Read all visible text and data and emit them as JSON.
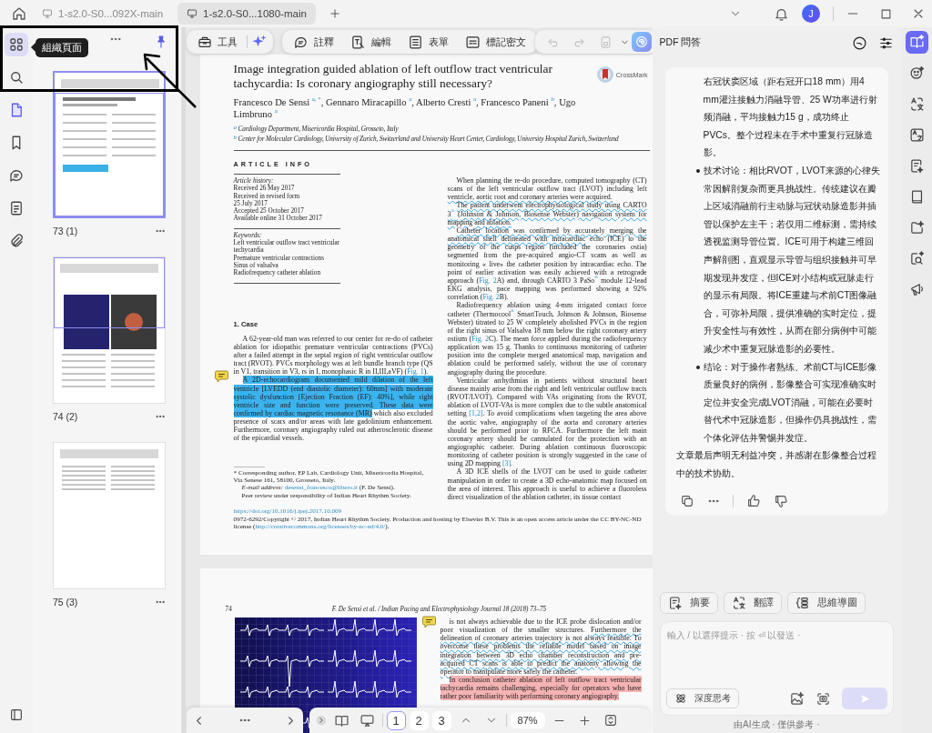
{
  "tabs": [
    {
      "title": "1-s2.0-S0...092X-main",
      "selected": false
    },
    {
      "title": "1-s2.0-S0...1080-main",
      "selected": true
    }
  ],
  "account": {
    "initial": "J"
  },
  "left_rail": [
    {
      "hovered": true,
      "selected": false
    },
    {
      "hovered": false,
      "selected": false
    },
    {
      "hovered": false,
      "selected": true
    },
    {
      "hovered": false,
      "selected": false
    },
    {
      "hovered": false,
      "selected": false
    },
    {
      "hovered": false,
      "selected": false
    },
    {
      "hovered": false,
      "selected": false
    }
  ],
  "tooltip": "組織頁面",
  "thumbnails": [
    {
      "label": "73 (1)",
      "selected": true,
      "in_view": true
    },
    {
      "label": "74 (2)",
      "selected": false,
      "in_view": true
    },
    {
      "label": "75 (3)",
      "selected": false,
      "in_view": false
    }
  ],
  "toolbar": {
    "tools_label": "工具",
    "items": [
      {
        "label": "註釋"
      },
      {
        "label": "編輯"
      },
      {
        "label": "表單"
      },
      {
        "label": "標記密文"
      }
    ],
    "history_buttons": [
      {
        "disabled": true
      },
      {
        "disabled": true
      },
      {
        "disabled": true
      }
    ],
    "ai_assistant": {
      "selected": true
    }
  },
  "document": {
    "page_1": {
      "title": "Image integration guided ablation of left outflow tract ventricular tachycardia: Is coronary angiography still necessary?",
      "crossmark": "CrossMark",
      "authors": "Francesco De Sensi $^{a, *}$, Gennaro Miracapillo $^{a}$, Alberto Cresti $^{a}$, Francesco Paneni $^{b}$, Ugo Limbruno $^{a}$",
      "affiliations": [
        "$^{a}$ Cardiology Department, Misericordia Hospital, Grosseto, Italy",
        "$^{b}$ Center for Molecular Cardiology, University of Zurich, Switzerland and University Heart Center, Cardiology, University Hospital Zurich, Switzerland"
      ],
      "article_info_heading": "ARTICLE INFO",
      "history": [
        "Article history:",
        "Received 26 May 2017",
        "Received in revised form",
        "25 July 2017",
        "Accepted 25 October 2017",
        "Available online 31 October 2017"
      ],
      "keywords": [
        "Keywords:",
        "Left ventricular outflow tract ventricular tachycardia",
        "Premature ventricular contractions",
        "Sinus of valsalva",
        "Radiofrequency catheter ablation"
      ],
      "section_heading": "1. Case",
      "left_paragraphs": [
        [
          {
            "kind": "plain",
            "text": "A 62-year-old man was referred to our center for re-do of catheter ablation for idiopathic premature ventricular contractions (PVCs) after a failed attempt in the septal region of right ventricular outflow tract (RVOT). PVCs morphology was at left bundle branch type (QS in V1, transition in V3, rs in I, monophasic R in II,III,aVF) ("
          },
          {
            "kind": "link",
            "text": "Fig. 1"
          },
          {
            "kind": "plain",
            "text": ")."
          }
        ],
        [
          {
            "kind": "highlight",
            "text": "A 2D-echocardiogram documented mild dilation of the left ventricle [LVEDD (end diastolic diameter): 60mm] with moderate systolic dysfunction [Ejection Fraction (EF): 40%], while right ventricle size and function were preserved. These data were confirmed by cardiac magnetic resonance (MR)"
          },
          {
            "kind": "plain",
            "text": " which also excluded presence of scars and/or areas with late gadolinium enhancement. Furthermore, coronary angiography ruled out atherosclerotic disease of the epicardial vessels."
          }
        ]
      ],
      "footnotes": [
        [
          {
            "kind": "plain",
            "text": "* Corresponding author. EP Lab, Cardiology Unit, Misericordia Hospital, Via Senese 161, 58100, Grosseto, Italy."
          }
        ],
        [
          {
            "kind": "plain",
            "text": "*E-mail address:* "
          },
          {
            "kind": "link",
            "text": "desensi_francesco@libero.it"
          },
          {
            "kind": "plain",
            "text": " (F. De Sensi)."
          }
        ],
        [
          {
            "kind": "plain",
            "text": "Peer review under responsibility of Indian Heart Rhythm Society."
          }
        ]
      ],
      "doi": "https://doi.org/10.1016/j.ipej.2017.10.009",
      "copyright": [
        {
          "kind": "plain",
          "text": "0972-6292/Copyright © 2017, Indian Heart Rhythm Society. Production and hosting by Elsevier B.V. This is an open access article under the CC BY-NC-ND license ("
        },
        {
          "kind": "link",
          "text": "http://creativecommons.org/licenses/by-nc-nd/4.0/"
        },
        {
          "kind": "plain",
          "text": ")."
        }
      ],
      "right_paragraphs": [
        [
          {
            "kind": "plain",
            "text": "When planning the re-do procedure, computed tomography (CT) scans of the left ventricular outflow tract (LVOT) including left "
          },
          {
            "kind": "underline",
            "text": "ventricle, aortic root and coronary arteries were acquired."
          }
        ],
        [
          {
            "kind": "underline",
            "text": "The patient underwent electrophysiological study using CARTO 3$^{®}$ (Johnson & Johnson, Biosense Webster) navigation system for mapping and ablation."
          }
        ],
        [
          {
            "kind": "underline",
            "text": "Catheter location was confirmed by accurately merging the anatomical shell delineated with intracardiac"
          },
          {
            "kind": "plain",
            "text": " echo (ICE) to the geometry of the cusps region (included the coronaries ostia) segmented from the pre-acquired angio-CT scans as well as monitoring « live» the catheter position by intracardiac echo. The point of earlier activation was easily achieved with a retrograde approach ("
          },
          {
            "kind": "link",
            "text": "Fig. 2"
          },
          {
            "kind": "plain",
            "text": "A) and, through CARTO 3 PaSo$^{®}$ module 12-lead EKG analysis, pace mapping was performed showing a 92% correlation ("
          },
          {
            "kind": "link",
            "text": "Fig. 2"
          },
          {
            "kind": "plain",
            "text": "B)."
          }
        ],
        [
          {
            "kind": "plain",
            "text": "Radiofrequency ablation using 4-mm irrigated contact force catheter (Thermocool$^{®}$ SmartTouch, Johnson & Johnson, Biosense Webster) titrated to 25 W completely abolished PVCs in the region of the right sinus of Valsalva 18 mm below the right coronary artery ostium ("
          },
          {
            "kind": "link",
            "text": "Fig. 2"
          },
          {
            "kind": "plain",
            "text": "C). The mean force applied during the radiofrequency application was 15 g. Thanks to continuous monitoring of catheter position into the complete merged anatomical map, navigation and ablation could be performed safely, without the use of coronary angiography during the procedure."
          }
        ],
        [
          {
            "kind": "plain",
            "text": "Ventricular arrhythmias in patients without structural heart disease mainly arise from the right and left ventricular outflow tracts (RVOT/LVOT). Compared with VAs originating from the RVOT, ablation of LVOT-VAs is more complex due to the subtle anatomical setting "
          },
          {
            "kind": "link",
            "text": "[1,2]"
          },
          {
            "kind": "plain",
            "text": ". To avoid complications when targeting the area above the aortic valve, angiography of the aorta and coronary arteries should be performed prior to RFCA. Furthermore the left main coronary artery should be cannulated for the protection with an angiographic catheter. During ablation continuous fluoroscopic monitoring of catheter position is strongly suggested in the case of using 2D mapping "
          },
          {
            "kind": "link",
            "text": "[3]"
          },
          {
            "kind": "plain",
            "text": "."
          }
        ],
        [
          {
            "kind": "plain",
            "text": "A 3D ICE shells of the LVOT can be used to guide catheter manipulation in order to create a 3D echo-anatomic map focused on the area of interest. This approach is useful to achieve a fluoroless direct visualization of the ablation catheter, its tissue contact"
          }
        ]
      ]
    },
    "page_2": {
      "page_number": "74",
      "running_head": "*F. De Sensi et al. / Indian Pacing and Electrophysiology Journal 18 (2018) 73–75*",
      "right_paragraphs": [
        [
          {
            "kind": "plain",
            "text": "is not always achievable due to the ICE probe dislocation and/or poor visualization of the smaller structures. "
          },
          {
            "kind": "underline",
            "text": "Furthermore the delineation of coronary arteries trajectory is not always feasible. To overcome these problems the reliable model based on image integration between 3D echo chamber reconstruction and pre-acquired CT scans is able to predict the anatomy allowing the operator to manipulate more safely the catheter."
          }
        ],
        [
          {
            "kind": "red",
            "text": "In conclusion catheter ablation of left outflow tract ventricular tachycardia remains challenging, especially for operators who have rather poor familiarity with performing coronary angiography."
          }
        ]
      ]
    }
  },
  "page_nav": {
    "pages": [
      {
        "label": "1",
        "selected": true
      },
      {
        "label": "2",
        "selected": false
      },
      {
        "label": "3",
        "selected": false
      }
    ],
    "zoom": "87%"
  },
  "ai_panel": {
    "title": "PDF 問答",
    "answer": [
      {
        "kind": "continuation",
        "text": "右冠状窦区域（距右冠开口18 mm）用4 mm灌注接触力消融导管、25 W功率进行射频消融，平均接触力15 g，成功终止PVCs。整个过程未在手术中重复行冠脉造影。"
      },
      {
        "kind": "bullet",
        "text": "技术讨论：相比RVOT，LVOT来源的心律失常因解剖复杂而更具挑战性。传统建议在瓣上区域消融前行主动脉与冠状动脉造影并插管以保护左主干；若仅用二维标测，需持续透视监测导管位置。ICE可用于构建三维回声解剖图，直观显示导管与组织接触并可早期发现并发症，但ICE对小结构或冠脉走行的显示有局限。将ICE重建与术前CT图像融合，可弥补局限，提供准确的实时定位，提升安全性与有效性，从而在部分病例中可能减少术中重复冠脉造影的必要性。"
      },
      {
        "kind": "bullet",
        "text": "结论：对于操作者熟练、术前CT与ICE影像质量良好的病例，影像整合可实现准确实时定位并安全完成LVOT消融，可能在必要时替代术中冠脉造影，但操作仍具挑战性，需个体化评估并警惕并发症。"
      },
      {
        "kind": "paragraph",
        "text": "文章最后声明无利益冲突，并感谢在影像整合过程中的技术协助。"
      }
    ],
    "chips": [
      {
        "label": "摘要"
      },
      {
        "label": "翻譯"
      },
      {
        "label": "思維導圖"
      }
    ],
    "input": {
      "placeholder": "輸入 / 以選擇提示 · 按 ⏎ 以發送 ·"
    },
    "deep_think": "深度思考",
    "footer": "由AI生成 · 僅供參考 ·"
  },
  "right_rail": [
    {
      "selected": true
    },
    {
      "selected": false
    },
    {
      "selected": false
    },
    {
      "selected": false
    },
    {
      "selected": false
    },
    {
      "selected": false
    },
    {
      "selected": false
    },
    {
      "selected": false
    },
    {
      "selected": false
    }
  ]
}
